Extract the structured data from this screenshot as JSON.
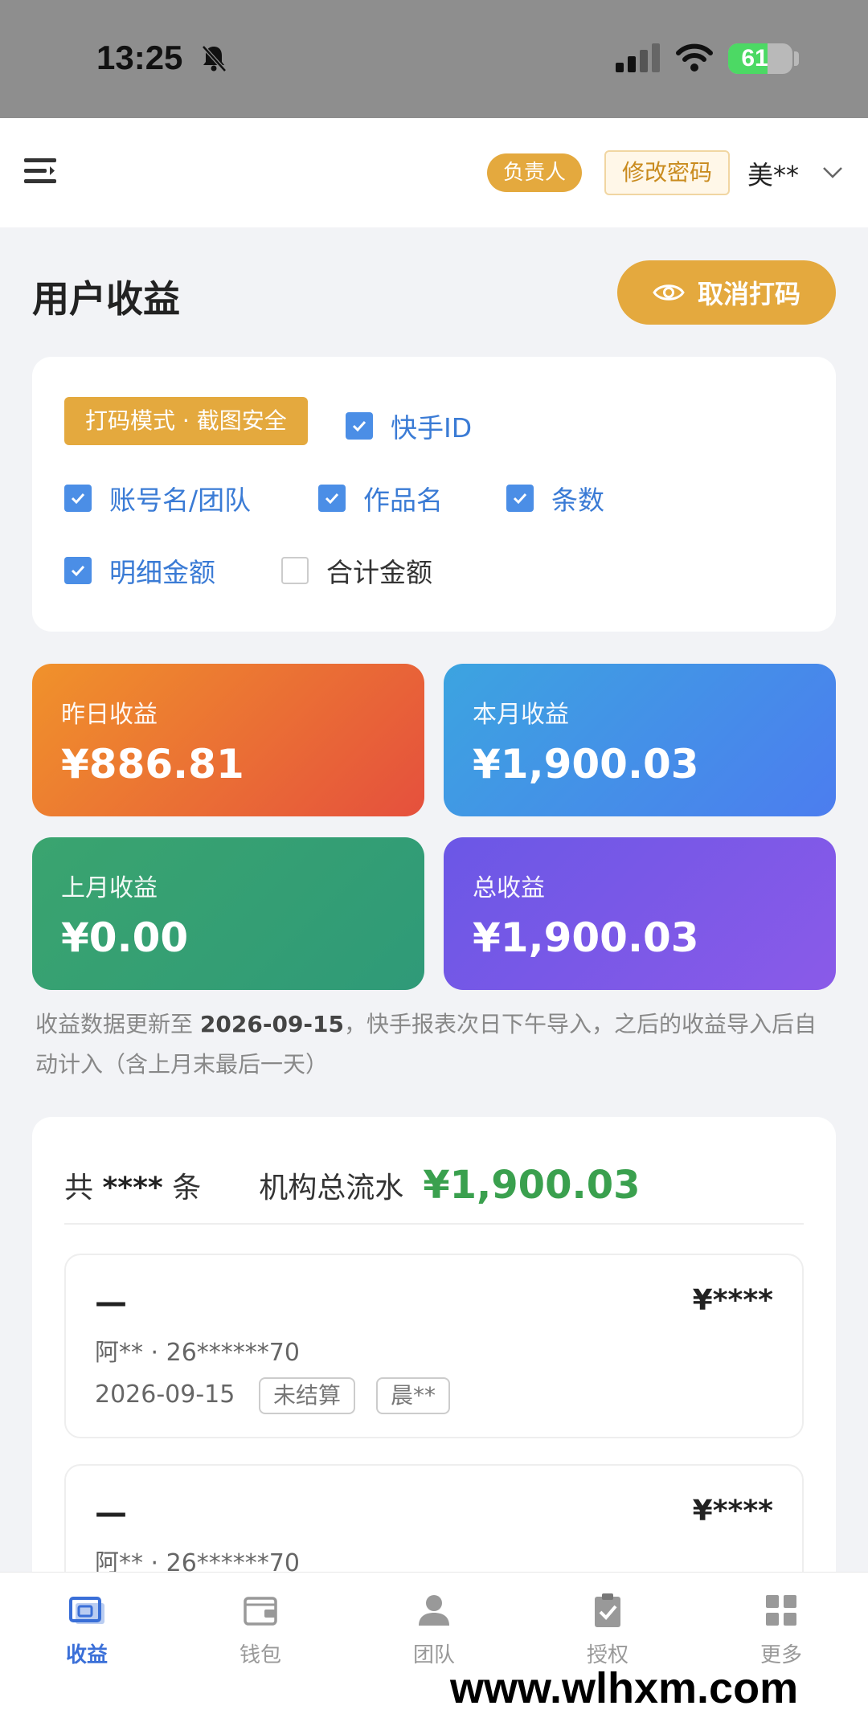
{
  "status_bar": {
    "time": "13:25",
    "battery": "61",
    "battery_level": 0.61
  },
  "header": {
    "role_badge": "负责人",
    "change_password": "修改密码",
    "user_name": "美**"
  },
  "page": {
    "title": "用户收益",
    "unmask_button": "取消打码"
  },
  "options": {
    "mode_tag": "打码模式 · 截图安全",
    "items": [
      {
        "label": "快手ID",
        "checked": true
      },
      {
        "label": "账号名/团队",
        "checked": true
      },
      {
        "label": "作品名",
        "checked": true
      },
      {
        "label": "条数",
        "checked": true
      },
      {
        "label": "明细金额",
        "checked": true
      },
      {
        "label": "合计金额",
        "checked": false
      }
    ]
  },
  "stats": {
    "yesterday": {
      "label": "昨日收益",
      "value": "¥886.81"
    },
    "this_month": {
      "label": "本月收益",
      "value": "¥1,900.03"
    },
    "last_month": {
      "label": "上月收益",
      "value": "¥0.00"
    },
    "total": {
      "label": "总收益",
      "value": "¥1,900.03"
    }
  },
  "update_note": {
    "prefix": "收益数据更新至 ",
    "date": "2026-09-15",
    "suffix": "，快手报表次日下午导入，之后的收益导入后自动计入（含上月末最后一天）"
  },
  "summary": {
    "count_prefix": "共 ",
    "count": "****",
    "count_suffix": " 条",
    "flow_label": "机构总流水",
    "flow_value": "¥1,900.03"
  },
  "records": [
    {
      "title": "—",
      "amount": "¥****",
      "account": "阿** · 26******70",
      "date": "2026-09-15",
      "status": "未结算",
      "user": "晨**"
    },
    {
      "title": "—",
      "amount": "¥****",
      "account": "阿** · 26******70"
    }
  ],
  "bottom_nav": {
    "earnings": "收益",
    "wallet": "钱包",
    "team": "团队",
    "auth": "授权",
    "more": "更多"
  },
  "watermark": "www.wlhxm.com",
  "colors": {
    "accent_gold": "#e4a93e",
    "active_blue": "#3a6fd8",
    "flow_green": "#3aa04e"
  }
}
